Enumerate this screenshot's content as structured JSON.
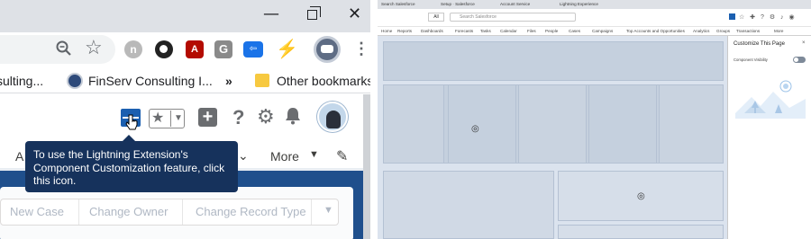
{
  "left": {
    "window_controls": {
      "minimize": "—",
      "maximize": "❐",
      "close": "✕"
    },
    "bookmarks": [
      {
        "label": "sulting..."
      },
      {
        "label": "FinServ Consulting I..."
      }
    ],
    "bookmarks_overflow": "»",
    "other_bookmarks": "Other bookmarks",
    "extensions": {
      "gray": "n",
      "pdf": "A",
      "g": "G",
      "blue": "⇦",
      "bolt": "⚡"
    },
    "header_icons": {
      "plus": "+",
      "help": "?",
      "gear": "⚙",
      "bell": "🔔",
      "fav_star": "★",
      "fav_caret": "▼"
    },
    "nav": {
      "first_letter": "A",
      "chevron": "⌄",
      "more": "More",
      "more_caret": "▼",
      "pencil": "✎"
    },
    "tooltip": "To use the Lightning Extension's Component Customization feature, click this icon.",
    "action_buttons": [
      "New Case",
      "Change Owner",
      "Change Record Type"
    ],
    "action_caret": "▼"
  },
  "right": {
    "tabs": [
      "Search Salesforce",
      "Setup · Salesforce",
      "Account Service",
      "Lightning Experience"
    ],
    "all_label": "All",
    "search_placeholder": "Search Salesforce",
    "nav_items": [
      "Home",
      "Reports",
      "Dashboards",
      "Forecasts",
      "Tasks",
      "Calendar",
      "Files",
      "People",
      "Cases",
      "Campaigns",
      "Top Accounts and Opportunities",
      "Analytics",
      "Groups",
      "Transactions",
      "More"
    ],
    "panel_title": "Customize This Page",
    "panel_close": "×",
    "component_visibility_label": "Component Visibility"
  }
}
